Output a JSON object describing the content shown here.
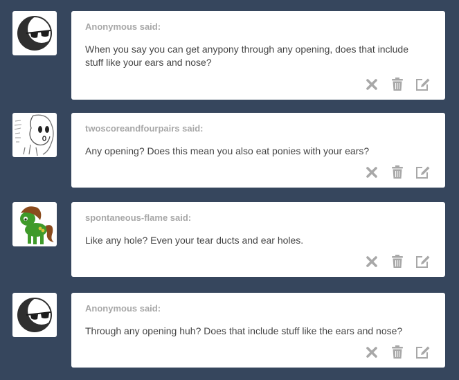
{
  "messages": [
    {
      "avatar": "sunglasses-moon-avatar",
      "sender": "Anonymous said:",
      "text": "When you say you can get anypony through any opening, does that include stuff like your ears and nose?"
    },
    {
      "avatar": "sketch-pony-avatar",
      "sender": "twoscoreandfourpairs said:",
      "text": "Any opening? Does this mean you also eat ponies with your ears?"
    },
    {
      "avatar": "green-pony-avatar",
      "sender": "spontaneous-flame said:",
      "text": "Like any hole? Even your tear ducts and ear holes."
    },
    {
      "avatar": "sunglasses-moon-avatar",
      "sender": "Anonymous said:",
      "text": "Through any opening huh? Does that include stuff like the ears and nose?"
    }
  ],
  "actions": {
    "delete_icon": "x-icon",
    "trash_icon": "trash-icon",
    "edit_icon": "edit-icon"
  },
  "colors": {
    "background": "#36465d",
    "card": "#ffffff",
    "sender_text": "#a7a7a7",
    "body_text": "#444444",
    "icon": "#a8a8a8"
  }
}
